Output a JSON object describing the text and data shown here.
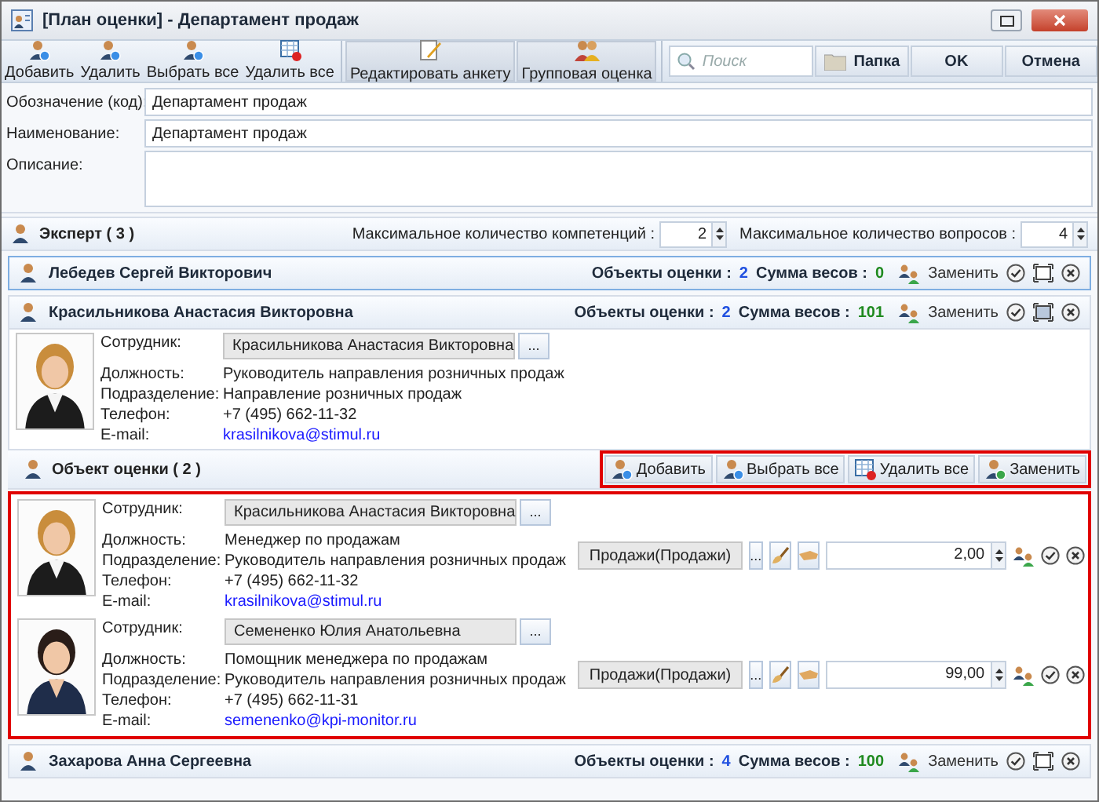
{
  "window": {
    "title": "[План оценки] - Департамент продаж"
  },
  "toolbar": {
    "buttons": [
      {
        "label": "Добавить",
        "kind": "add"
      },
      {
        "label": "Удалить",
        "kind": "remove"
      },
      {
        "label": "Выбрать все",
        "kind": "select"
      },
      {
        "label": "Удалить все",
        "kind": "clear"
      }
    ],
    "actions": [
      {
        "label": "Редактировать анкету",
        "kind": "edit"
      },
      {
        "label": "Групповая оценка",
        "kind": "group"
      }
    ],
    "search": {
      "placeholder": "Поиск"
    },
    "right_buttons": [
      {
        "label": "Папка",
        "kind": "folder"
      },
      {
        "label": "OK",
        "kind": "plain"
      },
      {
        "label": "Отмена",
        "kind": "plain"
      }
    ]
  },
  "form": [
    {
      "label": "Обозначение (код):",
      "value": "Департамент продаж",
      "kind": "line"
    },
    {
      "label": "Наименование:",
      "value": "Департамент продаж",
      "kind": "line"
    },
    {
      "label": "Описание:",
      "kind": "area"
    }
  ],
  "expert_section": {
    "title": "Эксперт ( 3 )",
    "limits": [
      {
        "label": "Максимальное количество компетенций :",
        "value": "2"
      },
      {
        "label": "Максимальное количество вопросов :",
        "value": "4"
      }
    ]
  },
  "experts": [
    {
      "name": "Лебедев Сергей Викторович",
      "selected": true,
      "expanded": false,
      "objects_label": "Объекты оценки :",
      "objects_count": "2",
      "weights_label": "Сумма весов :",
      "weights": "0",
      "replace": "Заменить"
    },
    {
      "name": "Красильникова Анастасия Викторовна",
      "selected": false,
      "expanded": true,
      "objects_label": "Объекты оценки :",
      "objects_count": "2",
      "weights_label": "Сумма весов :",
      "weights": "101",
      "replace": "Заменить",
      "employee": {
        "fields": [
          {
            "label": "Сотрудник:",
            "value": "Красильникова Анастасия Викторовна",
            "kind": "picker"
          },
          {
            "label": "Должность:",
            "value": "Руководитель направления розничных продаж",
            "kind": "text"
          },
          {
            "label": "Подразделение:",
            "value": "Направление розничных продаж",
            "kind": "text"
          },
          {
            "label": "Телефон:",
            "value": "+7 (495) 662-11-32",
            "kind": "text"
          },
          {
            "label": "E-mail:",
            "value": "krasilnikova@stimul.ru",
            "kind": "link"
          }
        ],
        "picker_button": "..."
      },
      "objects": {
        "title": "Объект оценки ( 2 )",
        "buttons": [
          {
            "label": "Добавить",
            "kind": "add"
          },
          {
            "label": "Выбрать все",
            "kind": "select"
          },
          {
            "label": "Удалить все",
            "kind": "clear"
          },
          {
            "label": "Заменить",
            "kind": "replace"
          }
        ],
        "items": [
          {
            "fields": [
              {
                "label": "Сотрудник:",
                "value": "Красильникова Анастасия Викторовна",
                "kind": "picker"
              },
              {
                "label": "Должность:",
                "value": "Менеджер по продажам",
                "kind": "text"
              },
              {
                "label": "Подразделение:",
                "value": "Руководитель направления розничных продаж",
                "kind": "text"
              },
              {
                "label": "Телефон:",
                "value": "+7 (495) 662-11-32",
                "kind": "text"
              },
              {
                "label": "E-mail:",
                "value": "krasilnikova@stimul.ru",
                "kind": "link"
              }
            ],
            "picker_button": "...",
            "competence": "Продажи(Продажи)",
            "competence_button": "...",
            "weight": "2,00"
          },
          {
            "fields": [
              {
                "label": "Сотрудник:",
                "value": "Семененко Юлия Анатольевна",
                "kind": "picker"
              },
              {
                "label": "Должность:",
                "value": "Помощник менеджера по продажам",
                "kind": "text"
              },
              {
                "label": "Подразделение:",
                "value": "Руководитель направления розничных продаж",
                "kind": "text"
              },
              {
                "label": "Телефон:",
                "value": "+7 (495) 662-11-31",
                "kind": "text"
              },
              {
                "label": "E-mail:",
                "value": "semenenko@kpi-monitor.ru",
                "kind": "link"
              }
            ],
            "picker_button": "...",
            "competence": "Продажи(Продажи)",
            "competence_button": "...",
            "weight": "99,00"
          }
        ]
      }
    },
    {
      "name": "Захарова Анна Сергеевна",
      "selected": false,
      "expanded": false,
      "objects_label": "Объекты оценки :",
      "objects_count": "4",
      "weights_label": "Сумма весов :",
      "weights": "100",
      "replace": "Заменить"
    }
  ]
}
